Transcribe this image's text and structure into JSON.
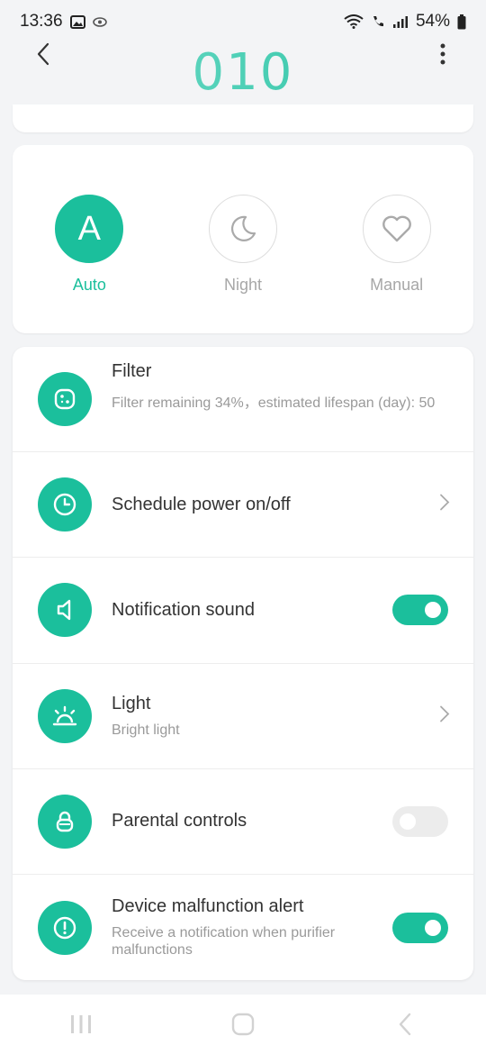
{
  "status_bar": {
    "time": "13:36",
    "battery": "54%"
  },
  "header": {
    "title": "010"
  },
  "modes": [
    {
      "letter": "A",
      "label": "Auto",
      "active": true
    },
    {
      "label": "Night",
      "active": false
    },
    {
      "label": "Manual",
      "active": false
    }
  ],
  "settings": {
    "filter": {
      "title": "Filter",
      "subtitle": "Filter remaining 34%，estimated lifespan (day): 50"
    },
    "schedule": {
      "title": "Schedule power on/off"
    },
    "notification_sound": {
      "title": "Notification sound",
      "enabled": true
    },
    "light": {
      "title": "Light",
      "subtitle": "Bright light"
    },
    "parental_controls": {
      "title": "Parental controls",
      "enabled": false
    },
    "malfunction_alert": {
      "title": "Device malfunction alert",
      "subtitle": "Receive a notification when purifier malfunctions",
      "enabled": true
    }
  },
  "colors": {
    "accent": "#1bbf9c",
    "background": "#f3f4f6"
  }
}
